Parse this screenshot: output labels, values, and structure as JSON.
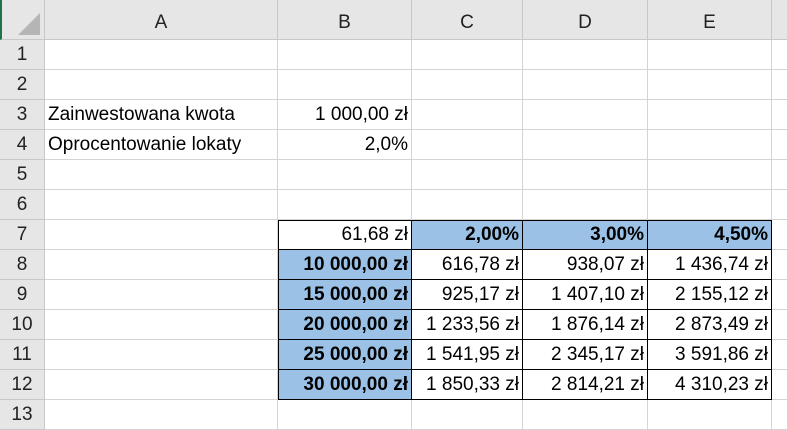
{
  "columns": [
    "A",
    "B",
    "C",
    "D",
    "E"
  ],
  "rows": [
    "1",
    "2",
    "3",
    "4",
    "5",
    "6",
    "7",
    "8",
    "9",
    "10",
    "11",
    "12",
    "13"
  ],
  "cells": {
    "A3": "Zainwestowana kwota",
    "B3": "1 000,00 zł",
    "A4": "Oprocentowanie lokaty",
    "B4": "2,0%",
    "B7": "61,68 zł",
    "C7": "2,00%",
    "D7": "3,00%",
    "E7": "4,50%"
  },
  "table": [
    {
      "amount": "10 000,00 zł",
      "values": [
        "616,78 zł",
        "938,07 zł",
        "1 436,74 zł"
      ]
    },
    {
      "amount": "15 000,00 zł",
      "values": [
        "925,17 zł",
        "1 407,10 zł",
        "2 155,12 zł"
      ]
    },
    {
      "amount": "20 000,00 zł",
      "values": [
        "1 233,56 zł",
        "1 876,14 zł",
        "2 873,49 zł"
      ]
    },
    {
      "amount": "25 000,00 zł",
      "values": [
        "1 541,95 zł",
        "2 345,17 zł",
        "3 591,86 zł"
      ]
    },
    {
      "amount": "30 000,00 zł",
      "values": [
        "1 850,33 zł",
        "2 814,21 zł",
        "4 310,23 zł"
      ]
    }
  ],
  "colors": {
    "highlight": "#9BC2E6",
    "header": "#E6E6E6",
    "grid": "#D4D4D4"
  }
}
